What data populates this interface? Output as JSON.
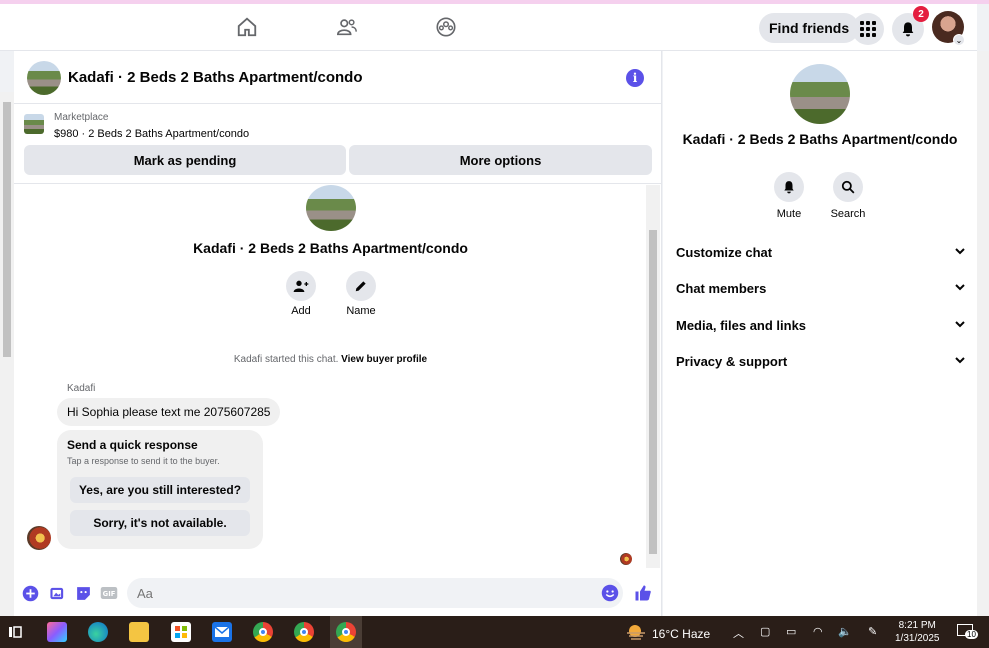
{
  "topbar": {
    "find_friends": "Find friends",
    "notifications_count": "2",
    "nav_icons": [
      "home-icon",
      "friends-icon",
      "groups-icon"
    ]
  },
  "chat": {
    "title": "Kadafi · 2 Beds 2 Baths Apartment/condo",
    "listing": {
      "label": "Marketplace",
      "price_line": "$980 · 2 Beds 2 Baths Apartment/condo",
      "mark_pending": "Mark as pending",
      "more_options": "More options"
    },
    "conversation_title": "Kadafi · 2 Beds 2 Baths Apartment/condo",
    "actions": {
      "add": "Add",
      "name": "Name"
    },
    "started_text": "Kadafi started this chat. ",
    "view_profile": "View buyer profile",
    "sender": "Kadafi",
    "message": "Hi Sophia please text me 2075607285",
    "quick_response": {
      "title": "Send a quick response",
      "subtitle": "Tap a response to send it to the buyer.",
      "options": [
        "Yes, are you still interested?",
        "Sorry, it's not available."
      ]
    },
    "composer_placeholder": "Aa"
  },
  "info_panel": {
    "title": "Kadafi · 2 Beds 2 Baths Apartment/condo",
    "mute": "Mute",
    "search": "Search",
    "sections": [
      "Customize chat",
      "Chat members",
      "Media, files and links",
      "Privacy & support"
    ]
  },
  "taskbar": {
    "weather": "16°C  Haze",
    "time": "8:21 PM",
    "date": "1/31/2025",
    "notification_count": "10"
  },
  "colors": {
    "accent": "#5b51e8",
    "like": "#0866ff",
    "badge": "#e41e3f"
  }
}
